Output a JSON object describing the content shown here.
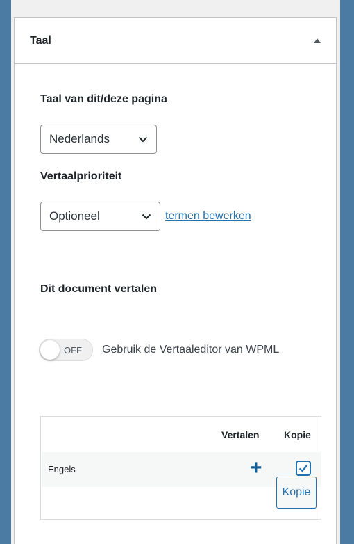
{
  "panel": {
    "title": "Taal"
  },
  "language": {
    "label": "Taal van dit/deze pagina",
    "selected": "Nederlands"
  },
  "priority": {
    "label": "Vertaalprioriteit",
    "selected": "Optioneel",
    "edit_link": "termen bewerken"
  },
  "translate": {
    "heading": "Dit document vertalen",
    "toggle_state": "OFF",
    "toggle_on": false,
    "toggle_desc": "Gebruik de Vertaaleditor van WPML"
  },
  "table": {
    "col_translate": "Vertalen",
    "col_copy": "Kopie",
    "rows": [
      {
        "language": "Engels",
        "translate_icon": "plus-icon",
        "copy_checked": true
      }
    ],
    "copy_button": "Kopie"
  },
  "colors": {
    "background": "#4b7aa2",
    "link": "#2271b1",
    "accent": "#135e96"
  }
}
